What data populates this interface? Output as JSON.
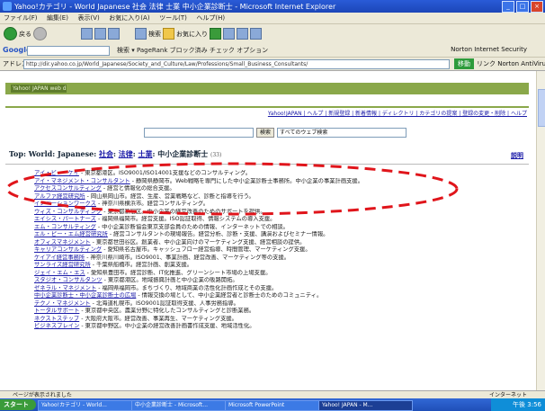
{
  "window": {
    "title": "Yahoo!カテゴリ - World Japanese 社会 法律 士業 中小企業診断士 - Microsoft Internet Explorer"
  },
  "menubar": [
    "ファイル(F)",
    "編集(E)",
    "表示(V)",
    "お気に入り(A)",
    "ツール(T)",
    "ヘルプ(H)"
  ],
  "toolbar": {
    "back": "戻る",
    "search": "検索",
    "favorites": "お気に入り"
  },
  "googlebar": {
    "logo": "Google",
    "tools": "検索 ▾  PageRank  ブロック済み  チェック  オプション",
    "norton": "Norton Internet Security"
  },
  "address": {
    "label": "アドレス(D)",
    "url": "http://dir.yahoo.co.jp/World_Japanese/Society_and_Culture/Law/Professions/Small_Business_Consultants/",
    "go": "移動",
    "links": "リンク  Norton AntiVirus"
  },
  "page": {
    "logo_text": "Yahoo! JAPAN  web directory project",
    "top_links": "Yahoo!JAPAN | ヘルプ | 新規登録 | 新着情報 | ディレクトリ | カテゴリの提案 | 登録の変更・削除 | ヘルプ",
    "search_button": "検索",
    "search_scope": "すべてのウェブ検索",
    "crumb_top": "Top: World: Japanese:",
    "crumb_society": "社会",
    "crumb_law": "法律",
    "crumb_prof": "士業",
    "crumb_current": ": 中小企業診断士",
    "crumb_count": "(33)",
    "right_link": "説明"
  },
  "listings": [
    {
      "name": "アイ・ビー・ケイ",
      "desc": " - 東京都港区。ISO9001/ISO14001支援などのコンサルティング。"
    },
    {
      "name": "アイ・マネジメント・コンサルタント",
      "desc": " - 静岡県静岡市。Web戦略を専門にした中小企業診断士事務所。中小企業の事業計画支援。"
    },
    {
      "name": "アクセスコンサルティング",
      "desc": " - 経営と情報化の総合支援。"
    },
    {
      "name": "アルファ経営研究所",
      "desc": " - 岡山県岡山市。経営、生産、営業戦略など、診断と指導を行う。"
    },
    {
      "name": "イノベーションワークス",
      "desc": " - 神奈川県横浜市。経営コンサルティング。"
    },
    {
      "name": "ウィズ・コンサルティング",
      "desc": " - 東京都新宿区。中小企業の経営改善のためのサポートを提供。"
    },
    {
      "name": "エイシス・パートナーズ",
      "desc": " - 福岡県福岡市。経営支援。ISO認証取得、情報システムの導入支援。"
    },
    {
      "name": "エム・コンサルティング",
      "desc": " - 中小企業診断協会東京支部会員のための情報、インターネットでの相談。"
    },
    {
      "name": "エル・ピー・エム経営研究所",
      "desc": " - 経営コンサルタントの現場報告。経営分析、診断・支援、講演およびセミナー情報。"
    },
    {
      "name": "オフィスマネジメント",
      "desc": " - 東京都世田谷区。創業者、中小企業向けのマーケティング支援、経営相談の提供。"
    },
    {
      "name": "キャリアコンサルティング",
      "desc": " - 愛知県名古屋市。キャッシュフロー経営指導、時間管理、マーケティング支援。"
    },
    {
      "name": "ケイアイ経営事務所",
      "desc": " - 神奈川県川崎市。ISO9001、事業計画、経営改善、マーケティング等の支援。"
    },
    {
      "name": "サンライズ経営研究所",
      "desc": " - 千葉県船橋市。経営計画、創業支援。"
    },
    {
      "name": "ジェイ・エム・エス",
      "desc": " - 愛知県豊田市。経営診断、IT化推進、グリーンシート市場の上場支援。"
    },
    {
      "name": "スタジオ・コンサルタンツ",
      "desc": " - 東京都港区。地域振興計画と中小企業の販路開拓。"
    },
    {
      "name": "ゼネラル・マネジメント",
      "desc": " - 福岡県福岡市。まちづくり、地域商業の活性化計画作成とその支援。"
    },
    {
      "name": "中小企業診断士・中小企業診断士の広場",
      "desc": " - 情報交換の場として、中小企業経営者と診断士のためのコミュニティ。"
    },
    {
      "name": "テクノ・マネジメント",
      "desc": " - 北海道札幌市。ISO9001認証取得支援、人事労務指導。"
    },
    {
      "name": "トータルサポート",
      "desc": " - 東京都中央区。農業分野に特化したコンサルティングと診断業務。"
    },
    {
      "name": "ネクストステップ",
      "desc": " - 大阪府大阪市。経営改善、事業再生、マーケティング支援。"
    },
    {
      "name": "ビジネスブレイン",
      "desc": " - 東京都中野区。中小企業の経営改善計画書作成支援、地域活性化。"
    }
  ],
  "status": {
    "text": "ページが表示されました",
    "zone": "インターネット"
  },
  "taskbar": {
    "start": "スタート",
    "tasks": [
      "Yahoo!カテゴリ - World...",
      "中小企業診断士 - Microsoft...",
      "Microsoft PowerPoint",
      "Yahoo! JAPAN - M..."
    ],
    "clock": "午後 3:56"
  }
}
